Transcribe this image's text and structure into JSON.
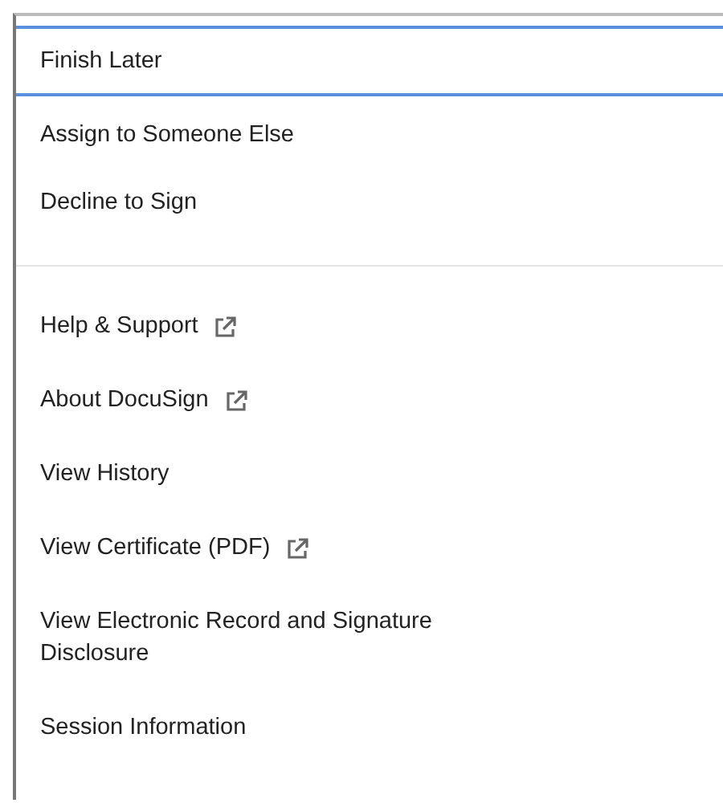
{
  "menu": {
    "sections": [
      {
        "items": [
          {
            "label": "Finish Later",
            "selected": true,
            "external": false
          },
          {
            "label": "Assign to Someone Else",
            "selected": false,
            "external": false
          },
          {
            "label": "Decline to Sign",
            "selected": false,
            "external": false
          }
        ]
      },
      {
        "items": [
          {
            "label": "Help & Support",
            "selected": false,
            "external": true
          },
          {
            "label": "About DocuSign",
            "selected": false,
            "external": true
          },
          {
            "label": "View History",
            "selected": false,
            "external": false
          },
          {
            "label": "View Certificate (PDF)",
            "selected": false,
            "external": true
          },
          {
            "label": "View Electronic Record and Signature Disclosure",
            "selected": false,
            "external": false
          },
          {
            "label": "Session Information",
            "selected": false,
            "external": false
          }
        ]
      }
    ]
  }
}
